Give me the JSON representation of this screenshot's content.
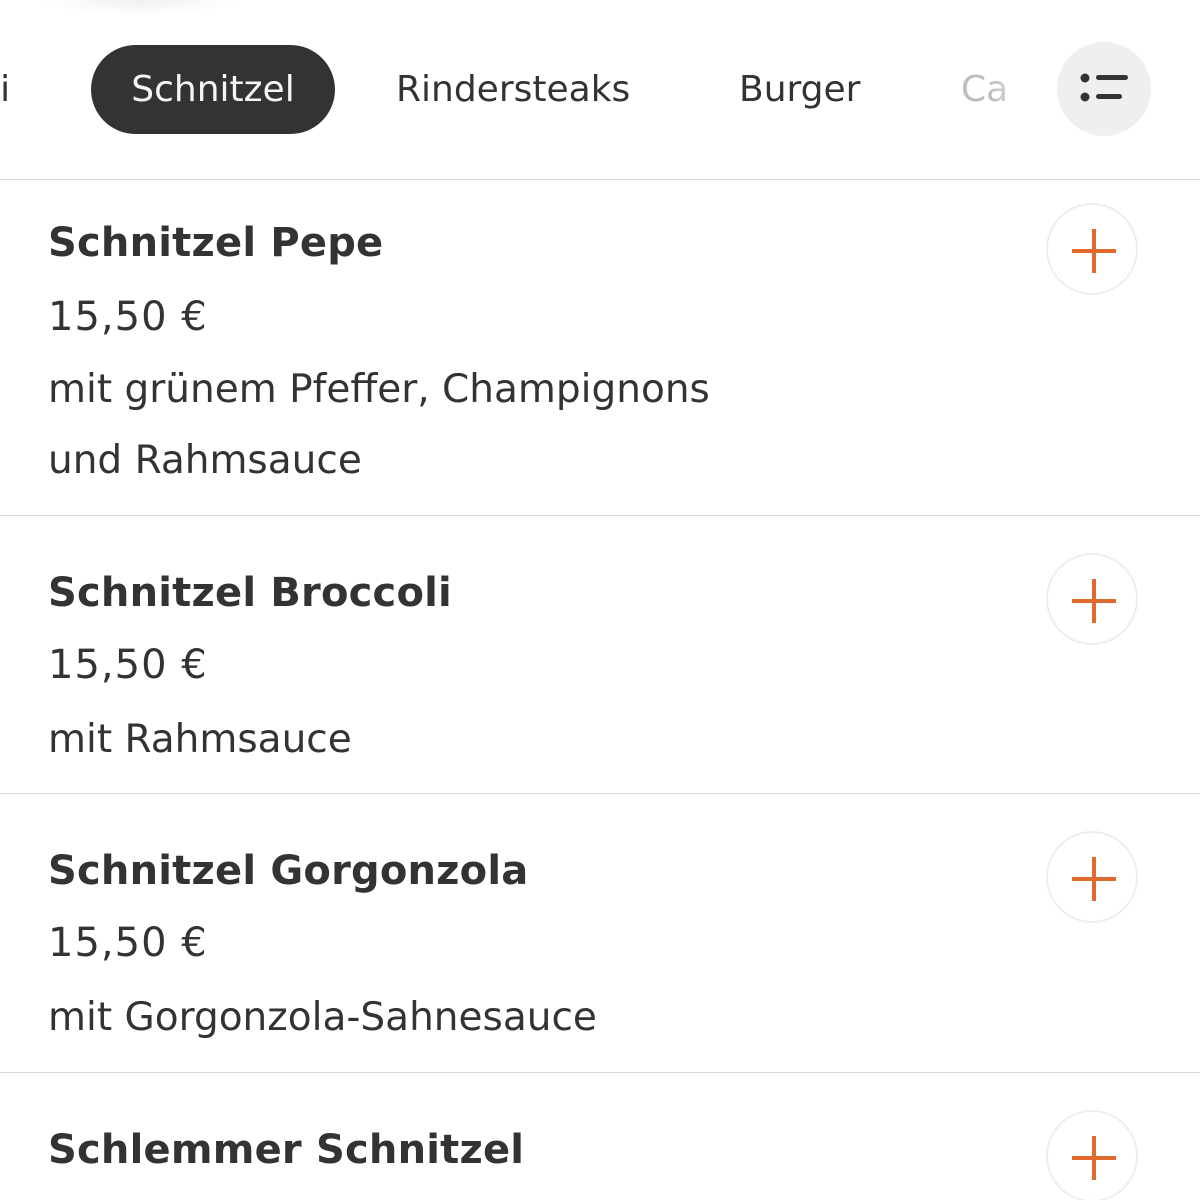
{
  "categories": {
    "partial_left": "ti",
    "active": "Schnitzel",
    "rindersteaks": "Rindersteaks",
    "burger": "Burger",
    "partial_right": "Ca"
  },
  "items": [
    {
      "name": "Schnitzel Pepe",
      "price": "15,50 €",
      "description_line1": "mit grünem Pfeffer, Champignons",
      "description_line2": "und Rahmsauce"
    },
    {
      "name": "Schnitzel Broccoli",
      "price": "15,50 €",
      "description_line1": "mit Rahmsauce"
    },
    {
      "name": "Schnitzel Gorgonzola",
      "price": "15,50 €",
      "description_line1": "mit Gorgonzola-Sahnesauce"
    },
    {
      "name": "Schlemmer Schnitzel"
    }
  ],
  "icons": {
    "menu": "list-icon",
    "add": "plus-icon"
  },
  "colors": {
    "accent": "#e0692c",
    "active_tab_bg": "#333333",
    "text": "#333333"
  }
}
